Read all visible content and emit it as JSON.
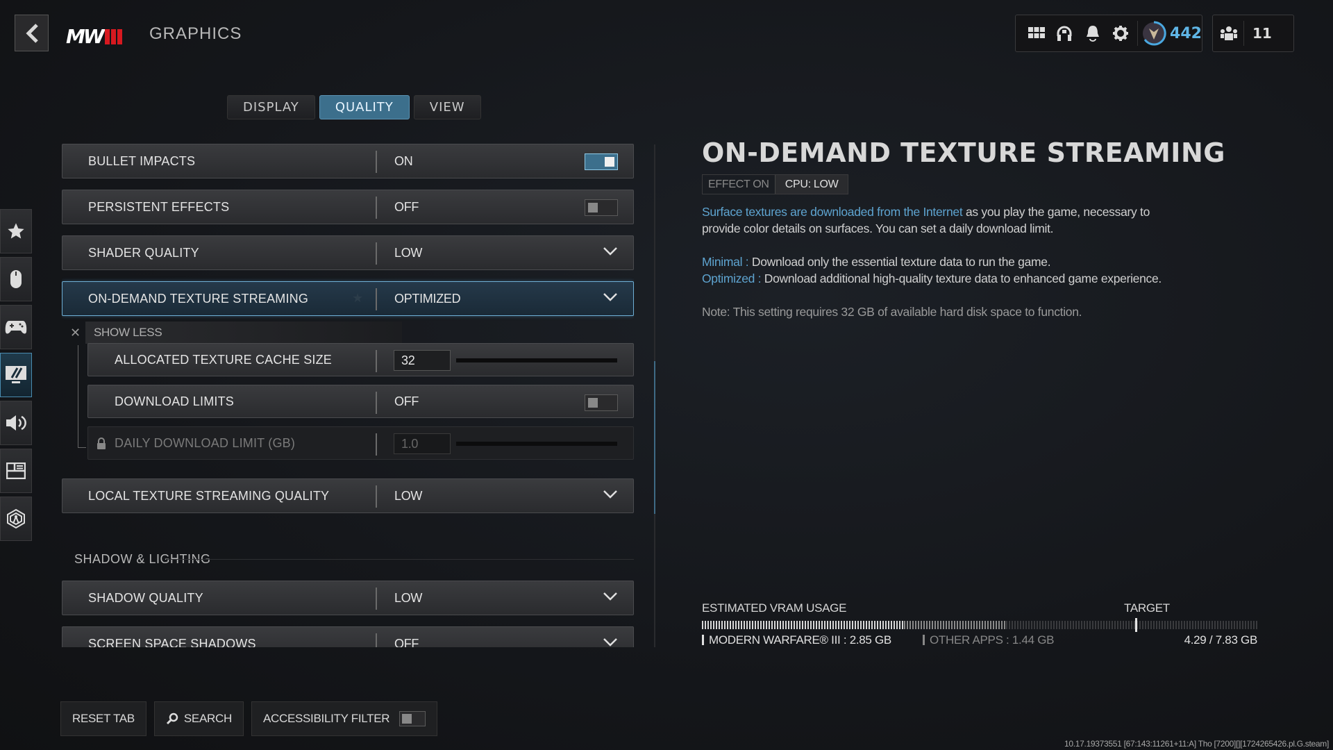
{
  "header": {
    "page_title": "GRAPHICS",
    "logo_text": "MW",
    "rank_value": "442",
    "party_count": "11",
    "icons": [
      "grid-menu-icon",
      "headset-icon",
      "bell-icon",
      "gear-icon",
      "rank-emblem-icon",
      "party-icon"
    ]
  },
  "tabs": [
    {
      "label": "DISPLAY",
      "active": false
    },
    {
      "label": "QUALITY",
      "active": true
    },
    {
      "label": "VIEW",
      "active": false
    }
  ],
  "rail": [
    {
      "name": "favorites",
      "icon": "star-icon",
      "active": false
    },
    {
      "name": "mouse",
      "icon": "mouse-icon",
      "active": false
    },
    {
      "name": "controller",
      "icon": "gamepad-icon",
      "active": false
    },
    {
      "name": "graphics",
      "icon": "monitor-icon",
      "active": true
    },
    {
      "name": "audio",
      "icon": "speaker-icon",
      "active": false
    },
    {
      "name": "interface",
      "icon": "layout-icon",
      "active": false
    },
    {
      "name": "network",
      "icon": "network-icon",
      "active": false
    }
  ],
  "settings": {
    "bullet_impacts": {
      "label": "BULLET IMPACTS",
      "value": "ON",
      "toggle_on": true
    },
    "persistent_effects": {
      "label": "PERSISTENT EFFECTS",
      "value": "OFF",
      "toggle_on": false
    },
    "shader_quality": {
      "label": "SHADER QUALITY",
      "value": "LOW"
    },
    "on_demand_texture_streaming": {
      "label": "ON-DEMAND TEXTURE STREAMING",
      "value": "OPTIMIZED"
    },
    "show_less": "SHOW LESS",
    "allocated_texture_cache_size": {
      "label": "ALLOCATED TEXTURE CACHE SIZE",
      "value": "32",
      "slider_fraction": 0.28
    },
    "download_limits": {
      "label": "DOWNLOAD LIMITS",
      "value": "OFF",
      "toggle_on": false
    },
    "daily_download_limit": {
      "label": "DAILY DOWNLOAD LIMIT (GB)",
      "value": "1.0",
      "slider_fraction": 0.0,
      "locked": true
    },
    "local_texture_streaming_quality": {
      "label": "LOCAL TEXTURE STREAMING QUALITY",
      "value": "LOW"
    },
    "section_shadow_lighting": "SHADOW & LIGHTING",
    "shadow_quality": {
      "label": "SHADOW QUALITY",
      "value": "LOW"
    },
    "screen_space_shadows": {
      "label": "SCREEN SPACE SHADOWS",
      "value": "OFF"
    }
  },
  "detail": {
    "title": "ON-DEMAND TEXTURE STREAMING",
    "effect_label": "EFFECT ON",
    "effect_value": "CPU: LOW",
    "desc_highlight": "Surface textures are downloaded from the Internet",
    "desc_line1_rest": " as you play the game, necessary to",
    "desc_line2": "provide color details on surfaces. You can set a daily download limit.",
    "minimal_label": "Minimal :",
    "minimal_text": " Download only the essential texture data to run the game.",
    "optimized_label": "Optimized :",
    "optimized_text": " Download additional high-quality texture data to enhanced game experience.",
    "note": "Note: This setting requires 32 GB of available hard disk space to function."
  },
  "vram": {
    "label": "ESTIMATED VRAM USAGE",
    "target_label": "TARGET",
    "game_label": "MODERN WARFARE® III : 2.85 GB",
    "other_label": "OTHER APPS : 1.44 GB",
    "total_label": "4.29 / 7.83 GB",
    "game_gb": 2.85,
    "other_gb": 1.44,
    "total_gb": 7.83,
    "target_fraction": 0.78
  },
  "bottom": {
    "reset_label": "RESET TAB",
    "search_label": "SEARCH",
    "accessibility_label": "ACCESSIBILITY FILTER",
    "accessibility_on": false
  },
  "version": "10.17.19373551 [67:143:11261+11:A] Tho [7200][][1724265426.pl.G.steam]"
}
